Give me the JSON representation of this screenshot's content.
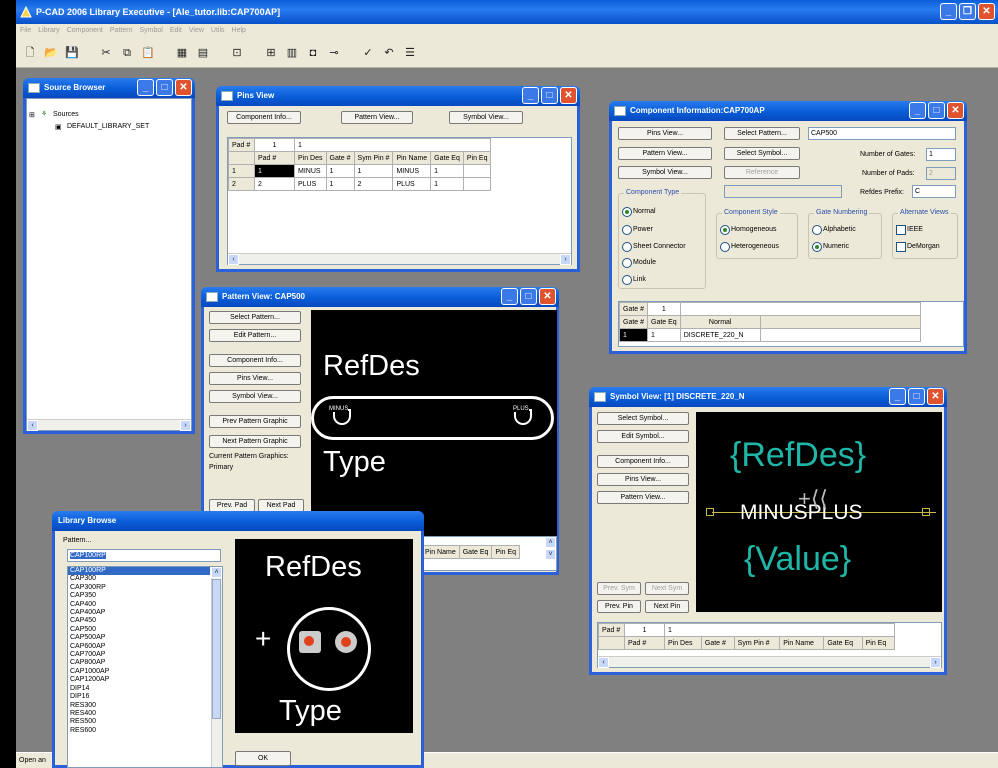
{
  "app": {
    "title": "P-CAD 2006 Library Executive - [Ale_tutor.lib:CAP700AP]",
    "menu": [
      "File",
      "Library",
      "Component",
      "Pattern",
      "Symbol",
      "Edit",
      "View",
      "Utils",
      "Help"
    ],
    "status": "Open an"
  },
  "source_browser": {
    "title": "Source Browser",
    "root": "Sources",
    "child": "DEFAULT_LIBRARY_SET"
  },
  "pins_view": {
    "title": "Pins View",
    "buttons": [
      "Component Info...",
      "Pattern View...",
      "Symbol View..."
    ],
    "pad_label": "Pad #",
    "pad_num": "1",
    "pad_val": "1",
    "columns": [
      "Pad #",
      "Pin Des",
      "Gate #",
      "Sym Pin #",
      "Pin Name",
      "Gate Eq",
      "Pin Eq"
    ],
    "rows": [
      [
        "1",
        "1",
        "MINUS",
        "1",
        "1",
        "MINUS",
        "1",
        ""
      ],
      [
        "2",
        "2",
        "PLUS",
        "1",
        "2",
        "PLUS",
        "1",
        ""
      ]
    ]
  },
  "comp_info": {
    "title": "Component Information:CAP700AP",
    "btn_pins": "Pins View...",
    "btn_pattern": "Pattern View...",
    "btn_symbol": "Symbol View...",
    "btn_sel_pattern": "Select Pattern...",
    "btn_sel_symbol": "Select Symbol...",
    "btn_reference": "Reference",
    "pattern_name": "CAP500",
    "lbl_gates": "Number of Gates:",
    "gates": "1",
    "lbl_pads": "Number of Pads:",
    "pads": "2",
    "lbl_refdes": "Refdes Prefix:",
    "refdes": "C",
    "type_title": "Component Type",
    "types": [
      "Normal",
      "Power",
      "Sheet Connector",
      "Module",
      "Link"
    ],
    "style_title": "Component Style",
    "styles": [
      "Homogeneous",
      "Heterogeneous"
    ],
    "numbering_title": "Gate Numbering",
    "numbering": [
      "Alphabetic",
      "Numeric"
    ],
    "alt_title": "Alternate Views",
    "alts": [
      "IEEE",
      "DeMorgan"
    ],
    "gate_label": "Gate #",
    "gate_num": "1",
    "gate_cols": [
      "Gate #",
      "Gate Eq",
      "Normal"
    ],
    "gate_row": [
      "1",
      "1",
      "DISCRETE_220_N"
    ]
  },
  "pattern_view": {
    "title": "Pattern View: CAP500",
    "btn_select": "Select Pattern...",
    "btn_edit": "Edit Pattern...",
    "btn_comp": "Component Info...",
    "btn_pins": "Pins View...",
    "btn_symbol": "Symbol View...",
    "btn_prev": "Prev Pattern Graphic",
    "btn_next": "Next Pattern Graphic",
    "graphics_label": "Current Pattern Graphics:",
    "graphics_value": "Primary",
    "btn_prev_pad": "Prev. Pad",
    "btn_next_pad": "Next Pad",
    "refdes": "RefDes",
    "type": "Type",
    "pin_minus": "MINUS",
    "pin_plus": "PLUS",
    "cols": [
      "Pin Name",
      "Gate Eq",
      "Pin Eq"
    ]
  },
  "symbol_view": {
    "title": "Symbol View: [1] DISCRETE_220_N",
    "btn_select": "Select Symbol...",
    "btn_edit": "Edit Symbol...",
    "btn_comp": "Component Info...",
    "btn_pins": "Pins View...",
    "btn_pattern": "Pattern View...",
    "btn_prev_sym": "Prev. Sym",
    "btn_next_sym": "Next Sym",
    "btn_prev_pin": "Prev. Pin",
    "btn_next_pin": "Next Pin",
    "refdes": "{RefDes}",
    "value": "{Value}",
    "pins_text": "MINUSPLUS",
    "pad_label": "Pad #",
    "pad_num": "1",
    "pad_val": "1",
    "cols": [
      "Pad #",
      "Pin Des",
      "Gate #",
      "Sym Pin #",
      "Pin Name",
      "Gate Eq",
      "Pin Eq"
    ]
  },
  "library_browse": {
    "title": "Library Browse",
    "pattern_label": "Pattern...",
    "selected": "CAP100RP",
    "items": [
      "CAP100RP",
      "CAP300",
      "CAP300RP",
      "CAP350",
      "CAP400",
      "CAP400AP",
      "CAP450",
      "CAP500",
      "CAP500AP",
      "CAP600AP",
      "CAP700AP",
      "CAP800AP",
      "CAP1000AP",
      "CAP1200AP",
      "DIP14",
      "DIP16",
      "RES300",
      "RES400",
      "RES500",
      "RES600"
    ],
    "refdes": "RefDes",
    "type": "Type",
    "ok": "OK"
  }
}
